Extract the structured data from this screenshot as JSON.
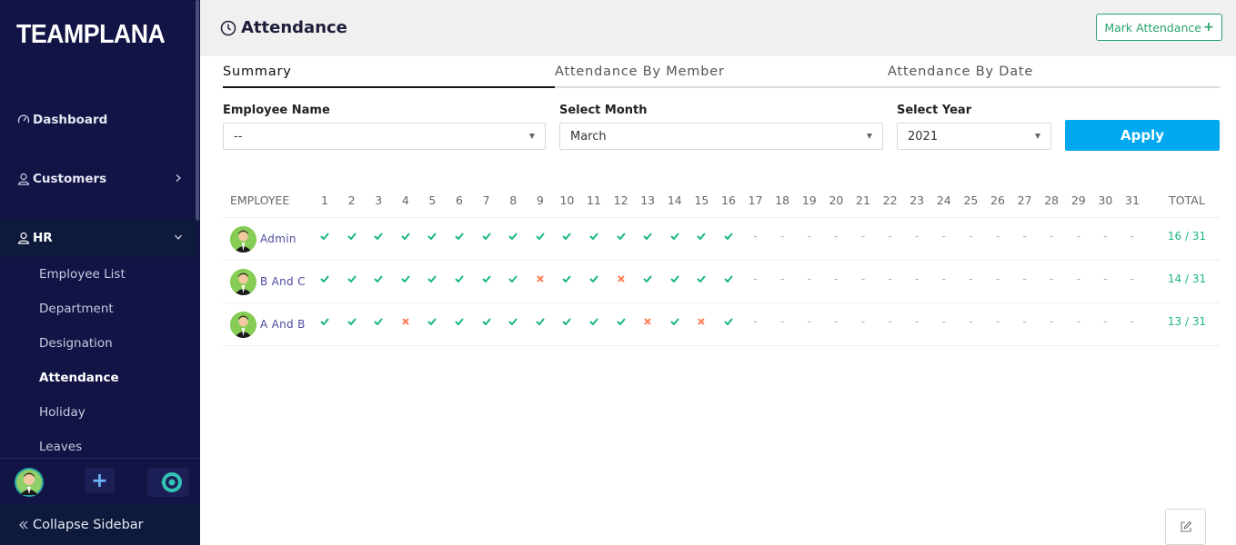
{
  "sidebar": {
    "logo": "TEAMPLANA",
    "nav": {
      "dashboard": "Dashboard",
      "customers": "Customers",
      "hr": "HR"
    },
    "hr_items": [
      "Employee List",
      "Department",
      "Designation",
      "Attendance",
      "Holiday",
      "Leaves"
    ],
    "active_item": "Attendance",
    "collapse_label": "Collapse Sidebar"
  },
  "header": {
    "title": "Attendance",
    "mark_button": "Mark Attendance"
  },
  "tabs": [
    "Summary",
    "Attendance By Member",
    "Attendance By Date"
  ],
  "filters": {
    "employee_label": "Employee Name",
    "employee_value": "--",
    "month_label": "Select Month",
    "month_value": "March",
    "year_label": "Select Year",
    "year_value": "2021",
    "apply_label": "Apply"
  },
  "table": {
    "employee_header": "EMPLOYEE",
    "total_header": "TOTAL",
    "days": [
      "1",
      "2",
      "3",
      "4",
      "5",
      "6",
      "7",
      "8",
      "9",
      "10",
      "11",
      "12",
      "13",
      "14",
      "15",
      "16",
      "17",
      "18",
      "19",
      "20",
      "21",
      "22",
      "23",
      "24",
      "25",
      "26",
      "27",
      "28",
      "29",
      "30",
      "31"
    ],
    "rows": [
      {
        "name": "Admin",
        "total": "16 / 31",
        "marks": [
          "P",
          "P",
          "P",
          "P",
          "P",
          "P",
          "P",
          "P",
          "P",
          "P",
          "P",
          "P",
          "P",
          "P",
          "P",
          "P",
          "-",
          "-",
          "-",
          "-",
          "-",
          "-",
          "-",
          "-",
          "-",
          "-",
          "-",
          "-",
          "-",
          "-",
          "-"
        ]
      },
      {
        "name": "B And C",
        "total": "14 / 31",
        "marks": [
          "P",
          "P",
          "P",
          "P",
          "P",
          "P",
          "P",
          "P",
          "A",
          "P",
          "P",
          "A",
          "P",
          "P",
          "P",
          "P",
          "-",
          "-",
          "-",
          "-",
          "-",
          "-",
          "-",
          "-",
          "-",
          "-",
          "-",
          "-",
          "-",
          "-",
          "-"
        ]
      },
      {
        "name": "A And B",
        "total": "13 / 31",
        "marks": [
          "P",
          "P",
          "P",
          "A",
          "P",
          "P",
          "P",
          "P",
          "P",
          "P",
          "P",
          "P",
          "A",
          "P",
          "A",
          "P",
          "-",
          "-",
          "-",
          "-",
          "-",
          "-",
          "-",
          "-",
          "-",
          "-",
          "-",
          "-",
          "-",
          "-",
          "-"
        ]
      }
    ]
  },
  "icons": {
    "present": "check-icon",
    "absent": "cross-icon",
    "none": "dash"
  },
  "colors": {
    "sidebar_bg": "#121446",
    "present": "#19b77d",
    "absent": "#ff7f5a",
    "apply": "#00a8f0",
    "mark_button": "#28a36a"
  }
}
